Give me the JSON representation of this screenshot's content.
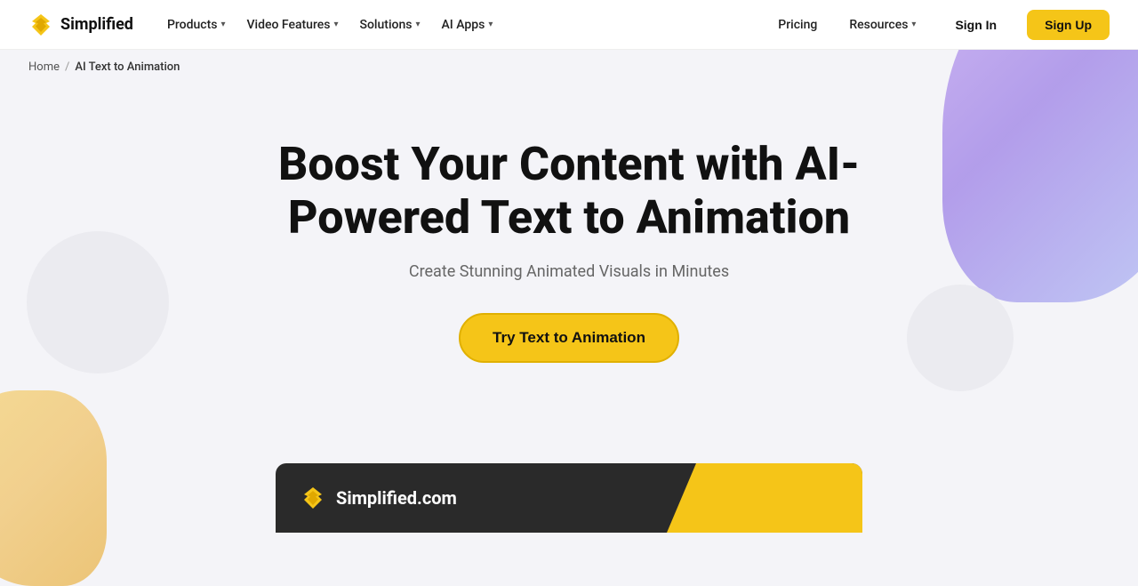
{
  "brand": {
    "name": "Simplified",
    "logo_icon": "⚡"
  },
  "navbar": {
    "left_items": [
      {
        "label": "Products",
        "has_dropdown": true
      },
      {
        "label": "Video Features",
        "has_dropdown": true
      },
      {
        "label": "Solutions",
        "has_dropdown": true
      },
      {
        "label": "AI Apps",
        "has_dropdown": true
      }
    ],
    "right_items": [
      {
        "label": "Pricing"
      },
      {
        "label": "Resources",
        "has_dropdown": true
      }
    ],
    "signin_label": "Sign In",
    "signup_label": "Sign Up"
  },
  "breadcrumb": {
    "home_label": "Home",
    "separator": "/",
    "current_label": "AI Text to Animation"
  },
  "hero": {
    "title": "Boost Your Content with AI-Powered Text to Animation",
    "subtitle": "Create Stunning Animated Visuals in Minutes",
    "cta_label": "Try Text to Animation"
  },
  "bottom_preview": {
    "logo_icon": "⚡",
    "logo_text": "Simplified.com"
  },
  "colors": {
    "accent": "#f5c518",
    "dark_card": "#2a2a2a"
  }
}
